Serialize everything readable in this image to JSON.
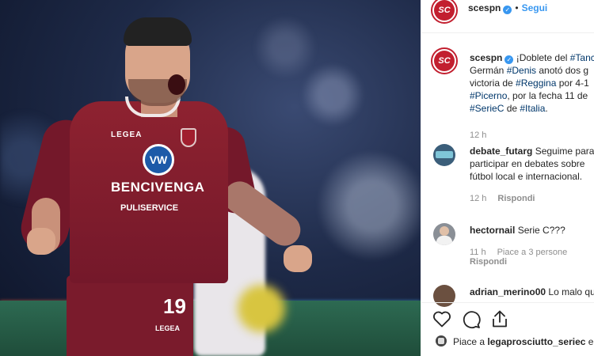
{
  "post": {
    "author": "scespn",
    "verified": true,
    "follow_label": "Segui",
    "caption_lines": [
      {
        "parts": [
          {
            "t": "¡Doblete del ",
            "tag": false
          },
          {
            "t": "#Tanc",
            "tag": true
          }
        ]
      },
      {
        "parts": [
          {
            "t": "Germán ",
            "tag": false
          },
          {
            "t": "#Denis",
            "tag": true
          },
          {
            "t": " anotó dos g",
            "tag": false
          }
        ]
      },
      {
        "parts": [
          {
            "t": "victoria de ",
            "tag": false
          },
          {
            "t": "#Reggina",
            "tag": true
          },
          {
            "t": " por 4-1",
            "tag": false
          }
        ]
      },
      {
        "parts": [
          {
            "t": "#Picerno",
            "tag": true
          },
          {
            "t": ", por la fecha 11 de",
            "tag": false
          }
        ]
      },
      {
        "parts": [
          {
            "t": "#SerieC",
            "tag": true
          },
          {
            "t": " de ",
            "tag": false
          },
          {
            "t": "#Italia",
            "tag": true
          },
          {
            "t": ".",
            "tag": false
          }
        ]
      }
    ],
    "caption_time": "12 h"
  },
  "photo": {
    "jersey_brand": "LEGEA",
    "sponsor": "BENCIVENGA",
    "sponsor2": "PULISERVICE",
    "number": "19",
    "logo": "VW"
  },
  "comments": [
    {
      "user": "debate_futarg",
      "lines": [
        "Seguime para",
        "participar en debates sobre",
        "fútbol local e internacional."
      ],
      "time": "12 h",
      "reply": "Rispondi",
      "likes": ""
    },
    {
      "user": "hectornail",
      "lines": [
        "Serie C???"
      ],
      "time": "11 h",
      "reply": "Rispondi",
      "likes": "Piace a 3 persone"
    },
    {
      "user": "adrian_merino00",
      "lines": [
        "Lo malo qu"
      ],
      "time": "",
      "reply": "",
      "likes": ""
    }
  ],
  "actions": {
    "like_icon": "heart-icon",
    "comment_icon": "comment-icon",
    "share_icon": "share-icon",
    "liked_by_prefix": "Piace a",
    "liked_by_user": "legaprosciutto_seriec",
    "liked_by_suffix": "e"
  },
  "colors": {
    "link": "#00376b",
    "follow": "#3897f0",
    "meta": "#8e8e8e",
    "club": "#74182a"
  }
}
